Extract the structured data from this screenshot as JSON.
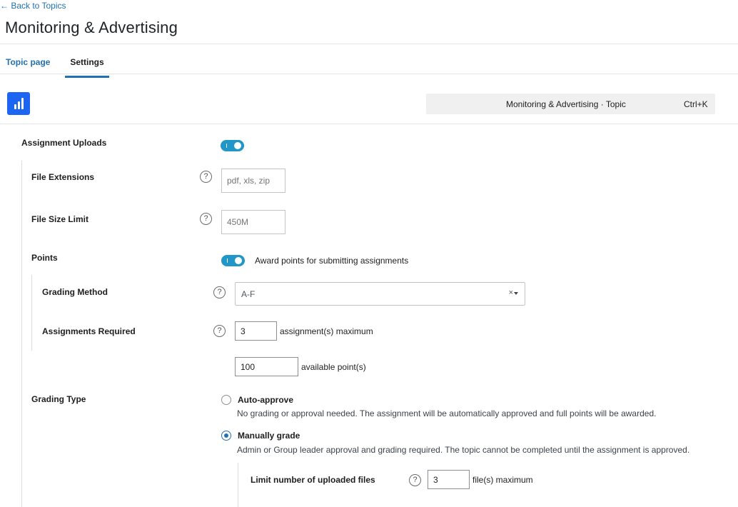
{
  "header": {
    "back_link": "← Back to Topics",
    "title": "Monitoring & Advertising"
  },
  "tabs": [
    {
      "label": "Topic page",
      "active": false
    },
    {
      "label": "Settings",
      "active": true
    }
  ],
  "command_bar": {
    "title": "Monitoring & Advertising · Topic",
    "shortcut": "Ctrl+K"
  },
  "settings": {
    "assignment_uploads": {
      "label": "Assignment Uploads",
      "enabled": true
    },
    "file_extensions": {
      "label": "File Extensions",
      "placeholder": "pdf, xls, zip",
      "help": "?"
    },
    "file_size_limit": {
      "label": "File Size Limit",
      "placeholder": "450M",
      "help": "?"
    },
    "points": {
      "label": "Points",
      "enabled": true,
      "toggle_label": "Award points for submitting assignments"
    },
    "grading_method": {
      "label": "Grading Method",
      "value": "A-F",
      "clear": "×",
      "help": "?"
    },
    "assignments_required": {
      "label": "Assignments Required",
      "value": "3",
      "suffix": "assignment(s) maximum",
      "help": "?"
    },
    "available_points": {
      "value": "100",
      "suffix": "available point(s)"
    },
    "grading_type": {
      "label": "Grading Type",
      "options": [
        {
          "title": "Auto-approve",
          "desc": "No grading or approval needed. The assignment will be automatically approved and full points will be awarded.",
          "selected": false
        },
        {
          "title": "Manually grade",
          "desc": "Admin or Group leader approval and grading required. The topic cannot be completed until the assignment is approved.",
          "selected": true
        }
      ]
    },
    "limit_uploaded_files": {
      "label": "Limit number of uploaded files",
      "value": "3",
      "suffix": "file(s) maximum",
      "help": "?"
    }
  },
  "colors": {
    "accent": "#2271b1",
    "toggle": "#2196c9",
    "logo": "#1c64f2"
  }
}
